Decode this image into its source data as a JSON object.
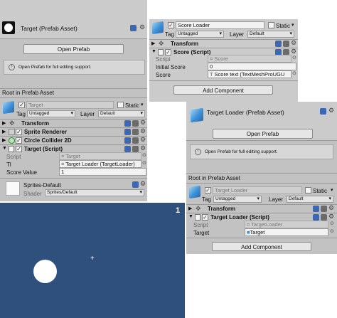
{
  "target_asset": {
    "title": "Target (Prefab Asset)",
    "open_prefab": "Open Prefab",
    "info": "Open Prefab for full editing support.",
    "root_label": "Root in Prefab Asset",
    "object_name": "Target",
    "static_label": "Static",
    "tag_label": "Tag",
    "tag_value": "Untagged",
    "layer_label": "Layer",
    "layer_value": "Default",
    "components": {
      "transform": "Transform",
      "sprite_renderer": "Sprite Renderer",
      "circle_collider": "Circle Collider 2D",
      "target_script": "Target (Script)"
    },
    "fields": [
      {
        "label": "Script",
        "value": "Target"
      },
      {
        "label": "Tl",
        "value": "Target Loader (TargetLoader)"
      },
      {
        "label": "Score Value",
        "value": "1"
      }
    ],
    "material_name": "Sprites-Default",
    "shader_label": "Shader",
    "shader_value": "Sprites/Default"
  },
  "score_loader": {
    "object_name": "Score Loader",
    "static_label": "Static",
    "tag_label": "Tag",
    "tag_value": "Untagged",
    "layer_label": "Layer",
    "layer_value": "Default",
    "transform": "Transform",
    "score_script": "Score (Script)",
    "fields": [
      {
        "label": "Script",
        "value": "Score"
      },
      {
        "label": "Initial Score",
        "value": "0"
      },
      {
        "label": "Score",
        "value": "Score text (TextMeshProUGU"
      }
    ],
    "add_component": "Add Component"
  },
  "target_loader_asset": {
    "title": "Target Loader (Prefab Asset)",
    "open_prefab": "Open Prefab",
    "info": "Open Prefab for full editing support.",
    "root_label": "Root in Prefab Asset",
    "object_name": "Target Loader",
    "static_label": "Static",
    "tag_label": "Tag",
    "tag_value": "Untagged",
    "layer_label": "Layer",
    "layer_value": "Default",
    "transform": "Transform",
    "loader_script": "Target Loader (Script)",
    "fields": [
      {
        "label": "Script",
        "value": "TargetLoader"
      },
      {
        "label": "Target",
        "value": "Target"
      }
    ],
    "add_component": "Add Component"
  },
  "game_view": {
    "display_number": "1",
    "background": "#2f4f7d",
    "cursor_symbol": "+"
  }
}
